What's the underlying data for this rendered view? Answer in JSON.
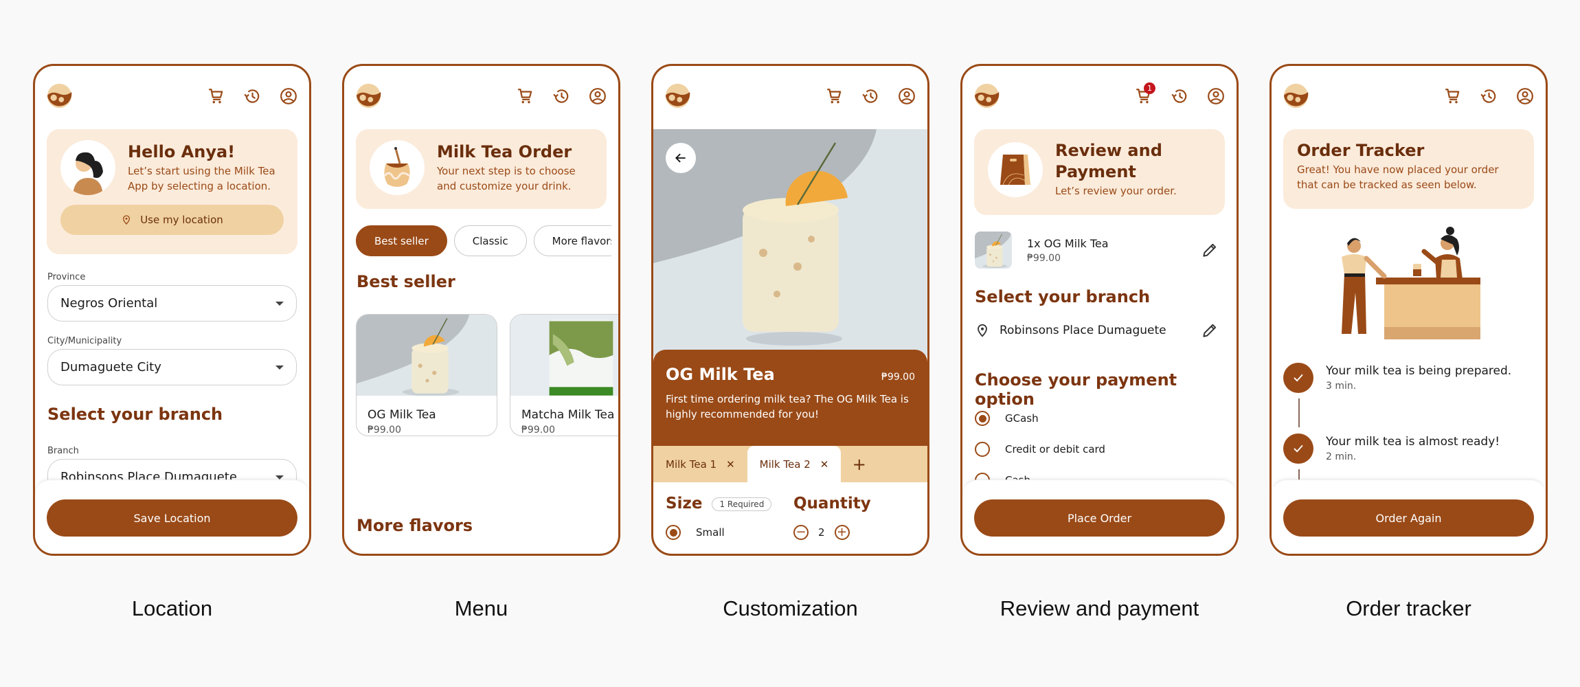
{
  "colors": {
    "brand": "#9a4a17",
    "brand_dark": "#6a2e0c",
    "banner_bg": "#fbebdb",
    "accent_light": "#f0d1a1",
    "badge_red": "#c4161c",
    "page_bg": "#f9f9f9"
  },
  "header_icons": [
    "app-logo",
    "cart-icon",
    "history-icon",
    "account-icon"
  ],
  "screens": {
    "location": {
      "caption": "Location",
      "banner": {
        "title": "Hello Anya!",
        "subtitle": "Let’s start using the Milk Tea App by selecting a location.",
        "button": "Use my location"
      },
      "province": {
        "label": "Province",
        "value": "Negros Oriental"
      },
      "city": {
        "label": "City/Municipality",
        "value": "Dumaguete City"
      },
      "branch_section": "Select your branch",
      "branch": {
        "label": "Branch",
        "value": "Robinsons Place Dumaguete"
      },
      "primary_button": "Save Location"
    },
    "menu": {
      "caption": "Menu",
      "banner": {
        "title": "Milk Tea Order",
        "subtitle": "Your next step is to choose and customize your drink."
      },
      "chips": [
        {
          "label": "Best seller",
          "active": true
        },
        {
          "label": "Classic",
          "active": false
        },
        {
          "label": "More flavors",
          "active": false
        }
      ],
      "section_title": "Best seller",
      "items": [
        {
          "name": "OG Milk Tea",
          "price": "₱99.00"
        },
        {
          "name": "Matcha Milk Tea",
          "price": "₱99.00"
        }
      ],
      "more_title": "More flavors"
    },
    "customization": {
      "caption": "Customization",
      "product": {
        "name": "OG Milk Tea",
        "price": "₱99.00",
        "description": "First time ordering milk tea? The OG Milk Tea is highly recommended for you!"
      },
      "tabs": [
        {
          "label": "Milk Tea 1",
          "active": false
        },
        {
          "label": "Milk Tea 2",
          "active": true
        }
      ],
      "add_tab": "+",
      "size": {
        "title": "Size",
        "badge": "1 Required",
        "options": [
          {
            "label": "Small",
            "selected": true
          }
        ]
      },
      "quantity": {
        "title": "Quantity",
        "value": "2"
      }
    },
    "review": {
      "caption": "Review and payment",
      "cart_badge": "1",
      "banner": {
        "title": "Review and Payment",
        "subtitle": "Let’s review your order."
      },
      "order_item": {
        "name": "1x OG Milk Tea",
        "price": "₱99.00"
      },
      "branch_section": "Select your branch",
      "branch_value": "Robinsons Place Dumaguete",
      "payment_section": "Choose your payment option",
      "payment_options": [
        {
          "label": "GCash",
          "selected": true
        },
        {
          "label": "Credit or debit card",
          "selected": false
        },
        {
          "label": "Cash",
          "selected": false
        }
      ],
      "primary_button": "Place Order"
    },
    "tracker": {
      "caption": "Order tracker",
      "banner": {
        "title": "Order Tracker",
        "subtitle": "Great! You have now placed your order that can be tracked as seen below."
      },
      "steps": [
        {
          "title": "Your milk tea is being prepared.",
          "time": "3 min.",
          "done": true
        },
        {
          "title": "Your milk tea is almost ready!",
          "time": "2 min.",
          "done": true
        }
      ],
      "primary_button": "Order Again"
    }
  }
}
